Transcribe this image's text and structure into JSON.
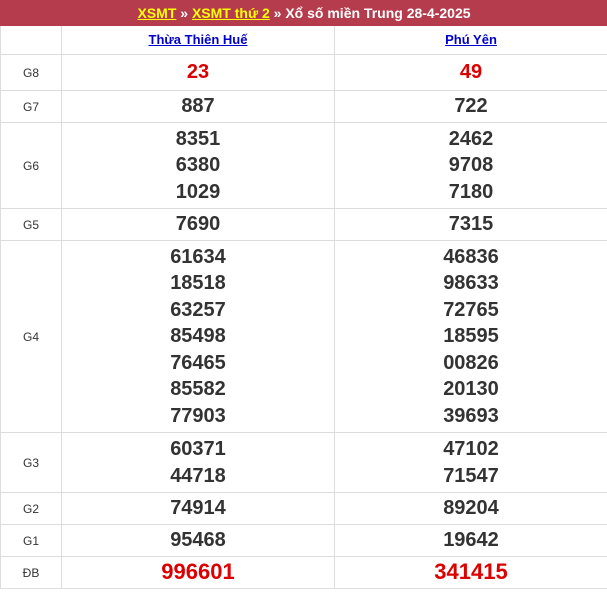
{
  "header": {
    "link1": "XSMT",
    "sep1": " » ",
    "link2": "XSMT thứ 2",
    "sep2": " » ",
    "text": "Xổ số miền Trung 28-4-2025"
  },
  "provinces": [
    "Thừa Thiên Huế",
    "Phú Yên"
  ],
  "colors": {
    "header_bg": "#b43c4c",
    "header_link": "#ffff00",
    "prize_red": "#dd0000",
    "province_link": "#0000cc"
  },
  "prizes": [
    {
      "label": "G8",
      "col1": [
        "23"
      ],
      "col2": [
        "49"
      ]
    },
    {
      "label": "G7",
      "col1": [
        "887"
      ],
      "col2": [
        "722"
      ]
    },
    {
      "label": "G6",
      "col1": [
        "8351",
        "6380",
        "1029"
      ],
      "col2": [
        "2462",
        "9708",
        "7180"
      ]
    },
    {
      "label": "G5",
      "col1": [
        "7690"
      ],
      "col2": [
        "7315"
      ]
    },
    {
      "label": "G4",
      "col1": [
        "61634",
        "18518",
        "63257",
        "85498",
        "76465",
        "85582",
        "77903"
      ],
      "col2": [
        "46836",
        "98633",
        "72765",
        "18595",
        "00826",
        "20130",
        "39693"
      ]
    },
    {
      "label": "G3",
      "col1": [
        "60371",
        "44718"
      ],
      "col2": [
        "47102",
        "71547"
      ]
    },
    {
      "label": "G2",
      "col1": [
        "74914"
      ],
      "col2": [
        "89204"
      ]
    },
    {
      "label": "G1",
      "col1": [
        "95468"
      ],
      "col2": [
        "19642"
      ]
    },
    {
      "label": "ĐB",
      "col1": [
        "996601"
      ],
      "col2": [
        "341415"
      ]
    }
  ]
}
